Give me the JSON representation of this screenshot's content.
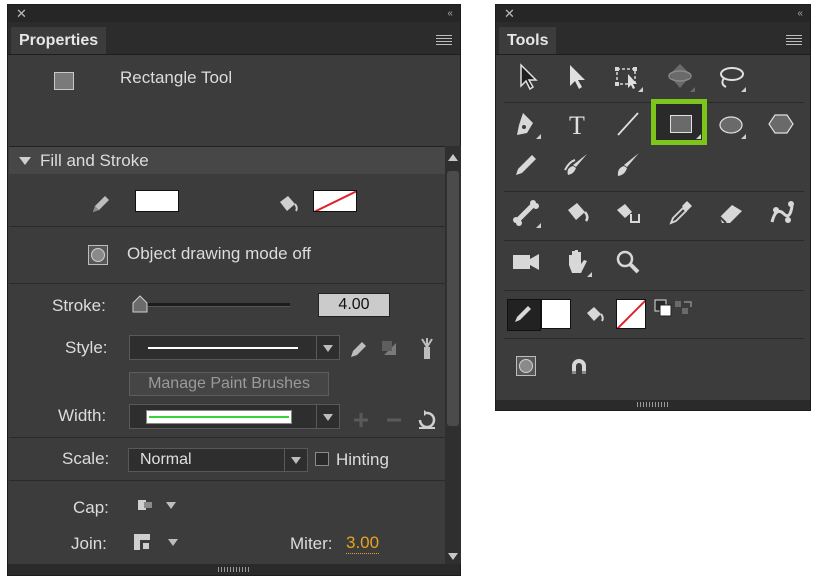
{
  "properties": {
    "panel_title": "Properties",
    "tool_name": "Rectangle Tool",
    "section_title": "Fill and Stroke",
    "object_drawing_label": "Object drawing mode off",
    "stroke_label": "Stroke:",
    "stroke_value": "4.00",
    "style_label": "Style:",
    "manage_brushes_label": "Manage Paint Brushes",
    "width_label": "Width:",
    "scale_label": "Scale:",
    "scale_value": "Normal",
    "hinting_label": "Hinting",
    "cap_label": "Cap:",
    "join_label": "Join:",
    "miter_label": "Miter:",
    "miter_value": "3.00",
    "accent_color": "#e8a31f"
  },
  "tools": {
    "panel_title": "Tools",
    "selected_tool": "rectangle-tool",
    "highlight_color": "#7cc51b",
    "rows": [
      [
        "selection-tool",
        "subselection-tool",
        "free-transform-tool",
        "3d-rotation-tool",
        "lasso-tool"
      ],
      [
        "pen-tool",
        "text-tool",
        "line-tool",
        "rectangle-tool",
        "oval-tool",
        "polystar-tool"
      ],
      [
        "pencil-tool",
        "brush-tool",
        "paint-brush-tool"
      ],
      [
        "bone-tool",
        "paint-bucket-tool",
        "ink-bottle-tool",
        "eyedropper-tool",
        "eraser-tool",
        "puppet-warp-tool"
      ],
      [
        "camera-tool",
        "hand-tool",
        "zoom-tool"
      ],
      [
        "stroke-color",
        "fill-color",
        "swap-colors"
      ],
      [
        "object-drawing-toggle",
        "snap-to-objects"
      ]
    ]
  }
}
